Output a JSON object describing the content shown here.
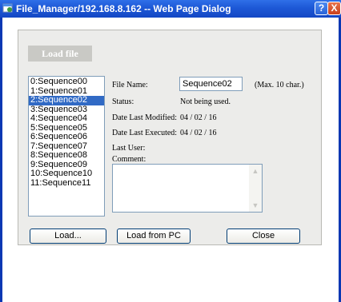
{
  "window": {
    "title": "File_Manager/192.168.8.162 -- Web Page Dialog",
    "help_label": "?",
    "close_label": "X"
  },
  "panel": {
    "title": "Load file"
  },
  "sequence_list": {
    "items": [
      "0:Sequence00",
      "1:Sequence01",
      "2:Sequence02",
      "3:Sequence03",
      "4:Sequence04",
      "5:Sequence05",
      "6:Sequence06",
      "7:Sequence07",
      "8:Sequence08",
      "9:Sequence09",
      "10:Sequence10",
      "11:Sequence11"
    ],
    "selected_index": 2
  },
  "details": {
    "file_name_label": "File Name:",
    "file_name_value": "Sequence02",
    "file_name_hint": "(Max. 10 char.)",
    "status_label": "Status:",
    "status_value": "Not being used.",
    "modified_label": "Date Last Modified:",
    "modified_value": "04 / 02 / 16",
    "executed_label": "Date Last Executed:",
    "executed_value": "04 / 02 / 16",
    "last_user_label": "Last User:",
    "last_user_value": "",
    "comment_label": "Comment:",
    "comment_value": ""
  },
  "buttons": {
    "load": "Load...",
    "load_pc": "Load from PC",
    "close": "Close"
  },
  "colors": {
    "titlebar": "#1d58d6",
    "selection": "#316ac5",
    "panel_bg": "#ececea"
  }
}
